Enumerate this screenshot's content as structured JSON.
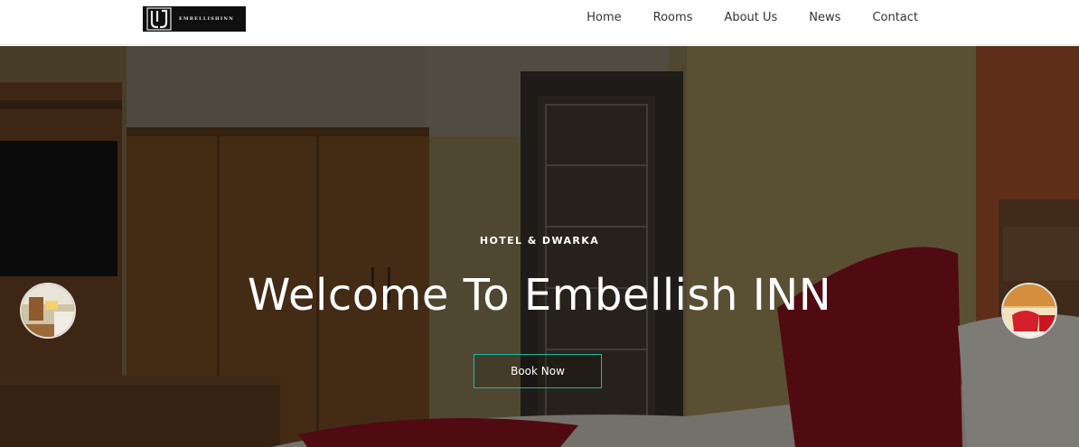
{
  "brand": {
    "logo_text": "EMBELLISHINN",
    "logo_icon": "ej-monogram-icon"
  },
  "nav": {
    "items": [
      {
        "label": "Home"
      },
      {
        "label": "Rooms"
      },
      {
        "label": "About Us"
      },
      {
        "label": "News"
      },
      {
        "label": "Contact"
      }
    ]
  },
  "hero": {
    "subtitle": "HOTEL & DWARKA",
    "title": "Welcome To Embellish INN",
    "cta_label": "Book Now",
    "background": "hotel-room-photo",
    "prev_thumb": "room-thumbnail-prev",
    "next_thumb": "room-thumbnail-next"
  },
  "colors": {
    "accent": "#1fb6a3",
    "header_bg": "#ffffff",
    "nav_text": "#333333",
    "hero_text": "#ffffff"
  }
}
